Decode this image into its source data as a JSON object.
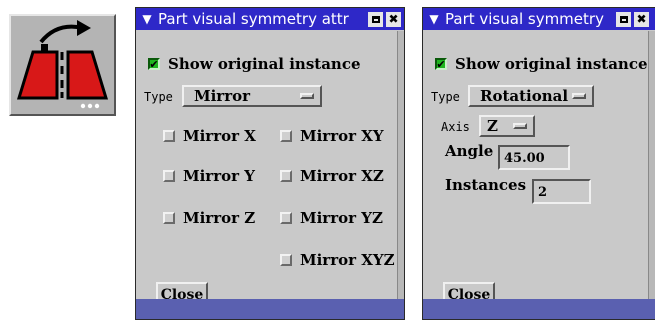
{
  "toolbar": {
    "icon": "part-visual-symmetry-icon"
  },
  "mirror_dialog": {
    "title": "Part visual symmetry attr",
    "show_original_label": "Show original instance",
    "show_original_checked": true,
    "type_label": "Type",
    "type_value": "Mirror",
    "options": {
      "mirror_x": "Mirror X",
      "mirror_xy": "Mirror XY",
      "mirror_y": "Mirror Y",
      "mirror_xz": "Mirror XZ",
      "mirror_z": "Mirror Z",
      "mirror_yz": "Mirror YZ",
      "mirror_xyz": "Mirror XYZ"
    },
    "close_label": "Close"
  },
  "rotational_dialog": {
    "title": "Part visual symmetry",
    "show_original_label": "Show original instance",
    "show_original_checked": true,
    "type_label": "Type",
    "type_value": "Rotational",
    "axis_label": "Axis",
    "axis_value": "Z",
    "angle_label": "Angle",
    "angle_value": "45.00",
    "instances_label": "Instances",
    "instances_value": "2",
    "close_label": "Close"
  },
  "colors": {
    "titlebar": "#2e28c8",
    "panel": "#c9c9c9",
    "check_on": "#1fb51f",
    "icon_red": "#d81818"
  }
}
